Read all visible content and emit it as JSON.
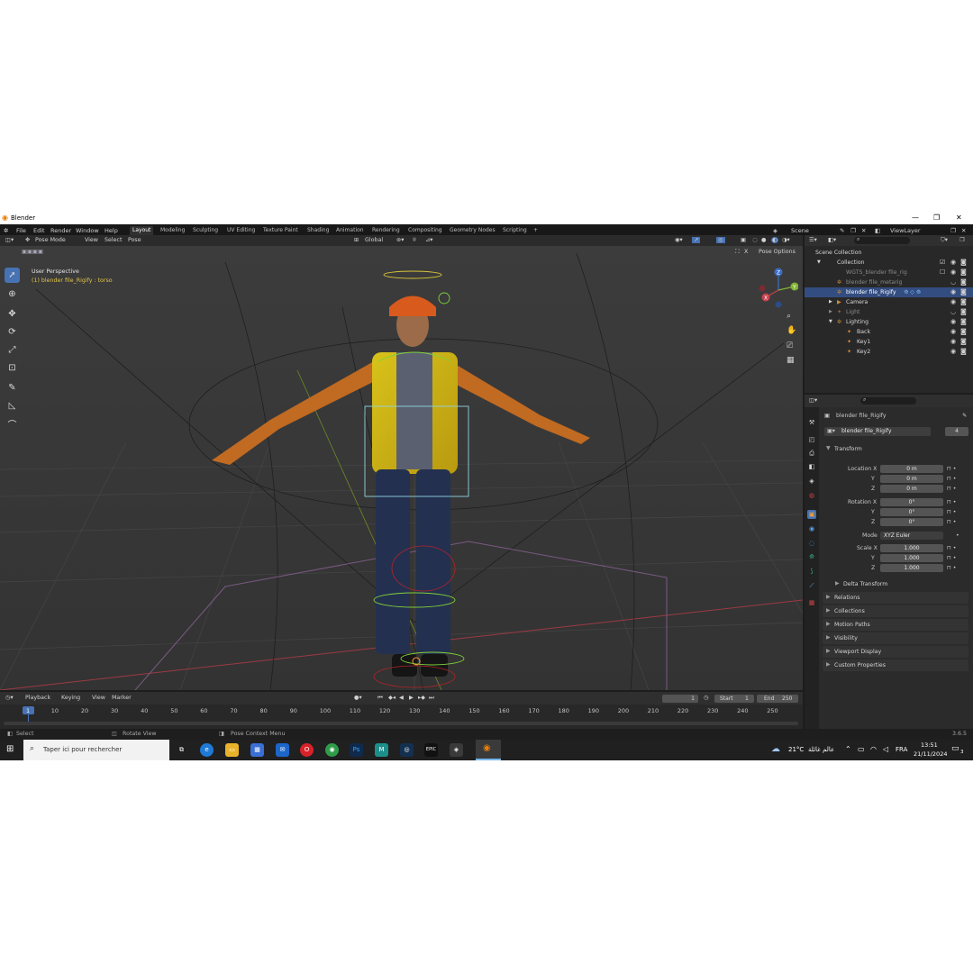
{
  "window": {
    "title": "Blender"
  },
  "menu": [
    "File",
    "Edit",
    "Render",
    "Window",
    "Help"
  ],
  "workspaces": [
    "Layout",
    "Modeling",
    "Sculpting",
    "UV Editing",
    "Texture Paint",
    "Shading",
    "Animation",
    "Rendering",
    "Compositing",
    "Geometry Nodes",
    "Scripting"
  ],
  "workspace_add": "+",
  "scene": {
    "name": "Scene",
    "view_layer": "ViewLayer"
  },
  "viewport": {
    "mode": "Pose Mode",
    "menus": [
      "View",
      "Select",
      "Pose"
    ],
    "orientation": "Global",
    "perspective": "User Perspective",
    "active_info": "(1) blender file_Rigify : torso",
    "pose_options": "Pose Options",
    "axes": [
      "Z",
      "Y",
      "X"
    ]
  },
  "outliner": {
    "rows": [
      {
        "label": "Scene Collection"
      },
      {
        "label": "Collection"
      },
      {
        "label": "WGTS_blender file_rig"
      },
      {
        "label": "blender file_metarig"
      },
      {
        "label": "blender file_Rigify"
      },
      {
        "label": "Camera"
      },
      {
        "label": "Light"
      },
      {
        "label": "Lighting"
      },
      {
        "label": "Back"
      },
      {
        "label": "Key1"
      },
      {
        "label": "Key2"
      }
    ]
  },
  "properties": {
    "object": "blender file_Rigify",
    "data_name": "blender file_Rigify",
    "users": "4",
    "transform_title": "Transform",
    "location": {
      "label": "Location X",
      "x": "0 m",
      "y": "0 m",
      "z": "0 m"
    },
    "rotation": {
      "label": "Rotation X",
      "x": "0°",
      "y": "0°",
      "z": "0°"
    },
    "mode_label": "Mode",
    "mode_value": "XYZ Euler",
    "scale": {
      "label": "Scale X",
      "x": "1.000",
      "y": "1.000",
      "z": "1.000"
    },
    "axis_y": "Y",
    "axis_z": "Z",
    "delta": "Delta Transform",
    "panels": [
      "Relations",
      "Collections",
      "Motion Paths",
      "Visibility",
      "Viewport Display",
      "Custom Properties"
    ]
  },
  "timeline": {
    "menus": [
      "Playback",
      "Keying",
      "View",
      "Marker"
    ],
    "current_frame": "1",
    "start_label": "Start",
    "start": "1",
    "end_label": "End",
    "end": "250",
    "ticks": [
      "1",
      "10",
      "20",
      "30",
      "40",
      "50",
      "60",
      "70",
      "80",
      "90",
      "100",
      "110",
      "120",
      "130",
      "140",
      "150",
      "160",
      "170",
      "180",
      "190",
      "200",
      "210",
      "220",
      "230",
      "240",
      "250"
    ]
  },
  "status": {
    "left": "Select",
    "middle": "Rotate View",
    "right": "Pose Context Menu",
    "version": "3.6.5"
  },
  "taskbar": {
    "search_placeholder": "Taper ici pour rechercher",
    "weather": "21°C",
    "weather_text": "عالم غائلة",
    "lang": "FRA",
    "time": "13:51",
    "date": "21/11/2024",
    "notif": "3"
  },
  "colors": {
    "accent": "#4772b3",
    "selected_row": "#334d80",
    "timeline_cursor": "#4772b3"
  }
}
